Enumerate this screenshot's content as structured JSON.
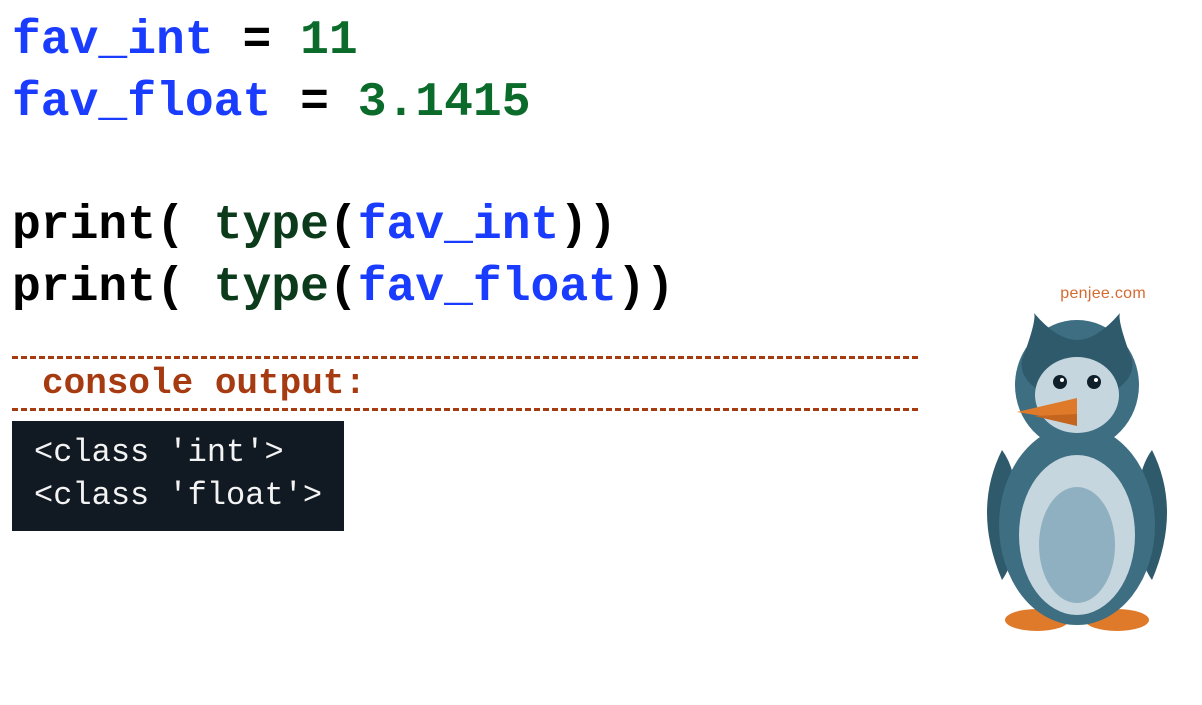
{
  "code": {
    "line1": {
      "var": "fav_int",
      "op": "=",
      "val": "11"
    },
    "line2": {
      "var": "fav_float",
      "op": "=",
      "val": "3.1415"
    },
    "line3": {
      "print": "print",
      "lparen1": "(",
      "space": " ",
      "type": "type",
      "lparen2": "(",
      "arg": "fav_int",
      "rparen": "))"
    },
    "line4": {
      "print": "print",
      "lparen1": "(",
      "space": " ",
      "type": "type",
      "lparen2": "(",
      "arg": "fav_float",
      "rparen": "))"
    }
  },
  "output": {
    "label": "console output:",
    "line1": "<class 'int'>",
    "line2": "<class 'float'>"
  },
  "watermark": "penjee.com",
  "colors": {
    "variable": "#1a3cff",
    "number": "#0b6b2b",
    "console_bg": "#111a22",
    "accent_brown": "#a63a11",
    "penguin_body": "#3d6e82",
    "penguin_belly_outer": "#c6d6de",
    "penguin_belly_inner": "#8fb0c0",
    "penguin_beak": "#e07a2b",
    "penguin_feet": "#e07a2b"
  }
}
